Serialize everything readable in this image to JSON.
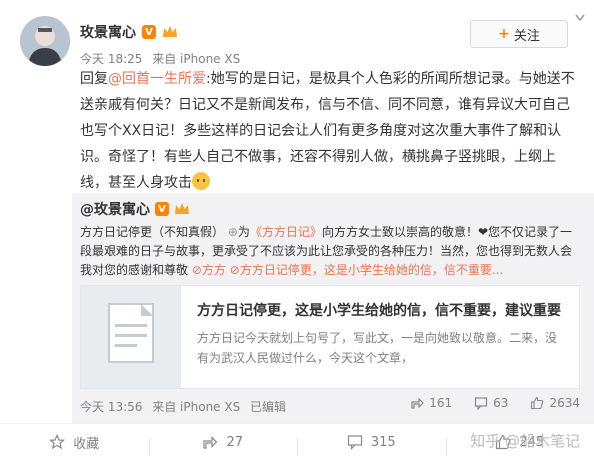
{
  "post": {
    "username": "玫景寓心",
    "time": "今天 18:25",
    "source": "来自 iPhone XS",
    "follow_label": "关注",
    "text_prefix": "回复",
    "mention": "@回首一生所爱",
    "text_body": ":她写的是日记，是极具个人色彩的所闻所想记录。与她送不送亲戚有何关？日记又不是新闻发布，信与不信、同不同意，谁有异议大可自己也写个XX日记！多些这样的日记会让人们有更多角度对这次重大事件了解和认识。奇怪了！有些人自己不做事，还容不得别人做，横挑鼻子竖挑眼，上纲上线，甚至人身攻击"
  },
  "repost": {
    "username": "@玫景寓心",
    "text_part1": "方方日记停更（不知真假）",
    "text_part2": "为",
    "tag": "《方方日记》",
    "text_part3": "向方方女士致以崇高的敬意！❤您不仅记录了一段最艰难的日子与故事，更承受了不应该为此让您承受的各种压力！当然，您也得到无数人会我对您的感谢和尊敬",
    "link_text": "方方",
    "link_card_label": "方方日记停更，这是小学生给她的信，信不重要...",
    "card": {
      "title": "方方日记停更，这是小学生给她的信，信不重要，建议重要",
      "desc": "方方日记今天就划上句号了，写此文，一是向她致以敬意。二来，没有为武汉人民做过什么，今天这个文章，"
    },
    "time": "今天 13:56",
    "source": "来自 iPhone XS",
    "edited": "已编辑",
    "shares": "161",
    "comments": "63",
    "likes": "2634"
  },
  "actions": {
    "favorite_label": "收藏",
    "share_count": "27",
    "comment_count": "315",
    "like_count": "245"
  },
  "watermark": "知乎 @船木笔记",
  "colors": {
    "accent": "#ff8200",
    "mention": "#eb7350"
  }
}
